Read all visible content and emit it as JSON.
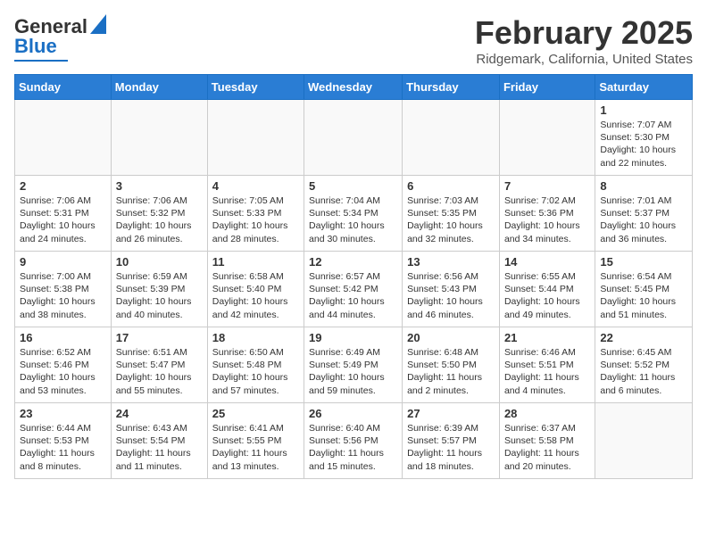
{
  "header": {
    "logo_general": "General",
    "logo_blue": "Blue",
    "month": "February 2025",
    "location": "Ridgemark, California, United States"
  },
  "weekdays": [
    "Sunday",
    "Monday",
    "Tuesday",
    "Wednesday",
    "Thursday",
    "Friday",
    "Saturday"
  ],
  "weeks": [
    [
      {
        "day": "",
        "detail": ""
      },
      {
        "day": "",
        "detail": ""
      },
      {
        "day": "",
        "detail": ""
      },
      {
        "day": "",
        "detail": ""
      },
      {
        "day": "",
        "detail": ""
      },
      {
        "day": "",
        "detail": ""
      },
      {
        "day": "1",
        "detail": "Sunrise: 7:07 AM\nSunset: 5:30 PM\nDaylight: 10 hours and 22 minutes."
      }
    ],
    [
      {
        "day": "2",
        "detail": "Sunrise: 7:06 AM\nSunset: 5:31 PM\nDaylight: 10 hours and 24 minutes."
      },
      {
        "day": "3",
        "detail": "Sunrise: 7:06 AM\nSunset: 5:32 PM\nDaylight: 10 hours and 26 minutes."
      },
      {
        "day": "4",
        "detail": "Sunrise: 7:05 AM\nSunset: 5:33 PM\nDaylight: 10 hours and 28 minutes."
      },
      {
        "day": "5",
        "detail": "Sunrise: 7:04 AM\nSunset: 5:34 PM\nDaylight: 10 hours and 30 minutes."
      },
      {
        "day": "6",
        "detail": "Sunrise: 7:03 AM\nSunset: 5:35 PM\nDaylight: 10 hours and 32 minutes."
      },
      {
        "day": "7",
        "detail": "Sunrise: 7:02 AM\nSunset: 5:36 PM\nDaylight: 10 hours and 34 minutes."
      },
      {
        "day": "8",
        "detail": "Sunrise: 7:01 AM\nSunset: 5:37 PM\nDaylight: 10 hours and 36 minutes."
      }
    ],
    [
      {
        "day": "9",
        "detail": "Sunrise: 7:00 AM\nSunset: 5:38 PM\nDaylight: 10 hours and 38 minutes."
      },
      {
        "day": "10",
        "detail": "Sunrise: 6:59 AM\nSunset: 5:39 PM\nDaylight: 10 hours and 40 minutes."
      },
      {
        "day": "11",
        "detail": "Sunrise: 6:58 AM\nSunset: 5:40 PM\nDaylight: 10 hours and 42 minutes."
      },
      {
        "day": "12",
        "detail": "Sunrise: 6:57 AM\nSunset: 5:42 PM\nDaylight: 10 hours and 44 minutes."
      },
      {
        "day": "13",
        "detail": "Sunrise: 6:56 AM\nSunset: 5:43 PM\nDaylight: 10 hours and 46 minutes."
      },
      {
        "day": "14",
        "detail": "Sunrise: 6:55 AM\nSunset: 5:44 PM\nDaylight: 10 hours and 49 minutes."
      },
      {
        "day": "15",
        "detail": "Sunrise: 6:54 AM\nSunset: 5:45 PM\nDaylight: 10 hours and 51 minutes."
      }
    ],
    [
      {
        "day": "16",
        "detail": "Sunrise: 6:52 AM\nSunset: 5:46 PM\nDaylight: 10 hours and 53 minutes."
      },
      {
        "day": "17",
        "detail": "Sunrise: 6:51 AM\nSunset: 5:47 PM\nDaylight: 10 hours and 55 minutes."
      },
      {
        "day": "18",
        "detail": "Sunrise: 6:50 AM\nSunset: 5:48 PM\nDaylight: 10 hours and 57 minutes."
      },
      {
        "day": "19",
        "detail": "Sunrise: 6:49 AM\nSunset: 5:49 PM\nDaylight: 10 hours and 59 minutes."
      },
      {
        "day": "20",
        "detail": "Sunrise: 6:48 AM\nSunset: 5:50 PM\nDaylight: 11 hours and 2 minutes."
      },
      {
        "day": "21",
        "detail": "Sunrise: 6:46 AM\nSunset: 5:51 PM\nDaylight: 11 hours and 4 minutes."
      },
      {
        "day": "22",
        "detail": "Sunrise: 6:45 AM\nSunset: 5:52 PM\nDaylight: 11 hours and 6 minutes."
      }
    ],
    [
      {
        "day": "23",
        "detail": "Sunrise: 6:44 AM\nSunset: 5:53 PM\nDaylight: 11 hours and 8 minutes."
      },
      {
        "day": "24",
        "detail": "Sunrise: 6:43 AM\nSunset: 5:54 PM\nDaylight: 11 hours and 11 minutes."
      },
      {
        "day": "25",
        "detail": "Sunrise: 6:41 AM\nSunset: 5:55 PM\nDaylight: 11 hours and 13 minutes."
      },
      {
        "day": "26",
        "detail": "Sunrise: 6:40 AM\nSunset: 5:56 PM\nDaylight: 11 hours and 15 minutes."
      },
      {
        "day": "27",
        "detail": "Sunrise: 6:39 AM\nSunset: 5:57 PM\nDaylight: 11 hours and 18 minutes."
      },
      {
        "day": "28",
        "detail": "Sunrise: 6:37 AM\nSunset: 5:58 PM\nDaylight: 11 hours and 20 minutes."
      },
      {
        "day": "",
        "detail": ""
      }
    ]
  ]
}
